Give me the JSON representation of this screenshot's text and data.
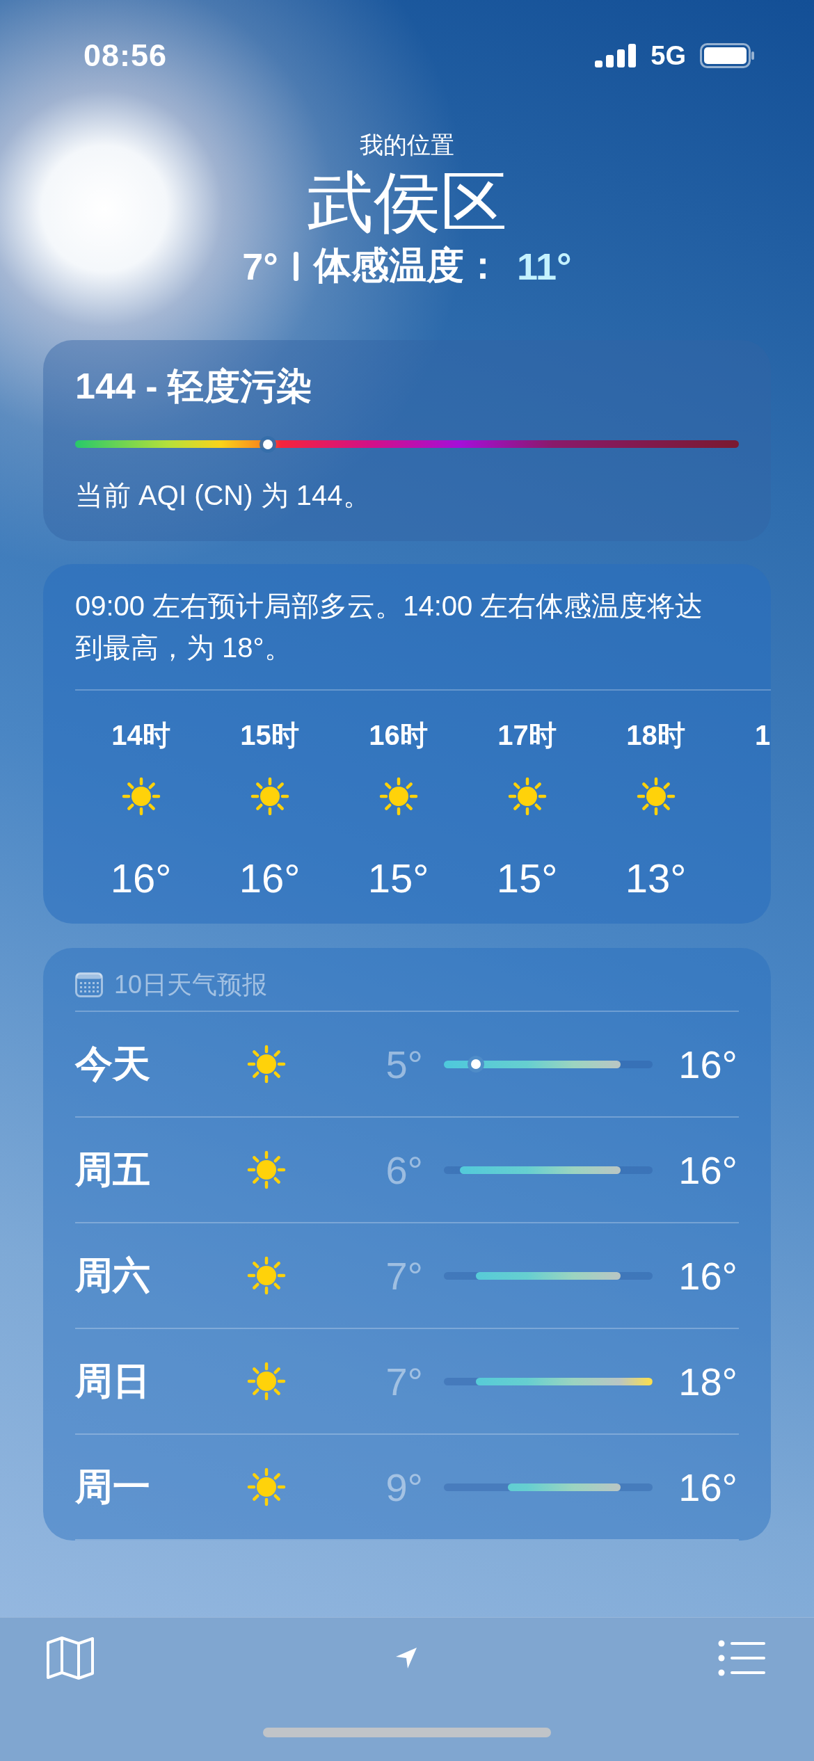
{
  "status_bar": {
    "time": "08:56",
    "network": "5G"
  },
  "header": {
    "caption": "我的位置",
    "city": "武侯区",
    "temperature": "7°",
    "feels_like_label": "体感温度：",
    "feels_like_value": "11°"
  },
  "air_quality": {
    "title": "144 - 轻度污染",
    "level": 0.29,
    "description": "当前 AQI (CN) 为 144。"
  },
  "hourly": {
    "summary": "09:00 左右预计局部多云。14:00 左右体感温度将达到最高，为 18°。",
    "hours": [
      {
        "kind": "full",
        "time": "14时",
        "temp": "16°"
      },
      {
        "kind": "full",
        "time": "15时",
        "temp": "16°"
      },
      {
        "kind": "full",
        "time": "16时",
        "temp": "15°"
      },
      {
        "kind": "full",
        "time": "17时",
        "temp": "15°"
      },
      {
        "kind": "full",
        "time": "18时",
        "temp": "13°"
      },
      {
        "kind": "partial",
        "time": "1"
      }
    ]
  },
  "forecast": {
    "title": "10日天气预报",
    "days": [
      {
        "day": "今天",
        "low": "5°",
        "high": "16°",
        "current_marker": true
      },
      {
        "day": "周五",
        "low": "6°",
        "high": "16°",
        "current_marker": false
      },
      {
        "day": "周六",
        "low": "7°",
        "high": "16°",
        "current_marker": false
      },
      {
        "day": "周日",
        "low": "7°",
        "high": "18°",
        "current_marker": false
      },
      {
        "day": "周一",
        "low": "9°",
        "high": "16°",
        "current_marker": false
      }
    ]
  }
}
